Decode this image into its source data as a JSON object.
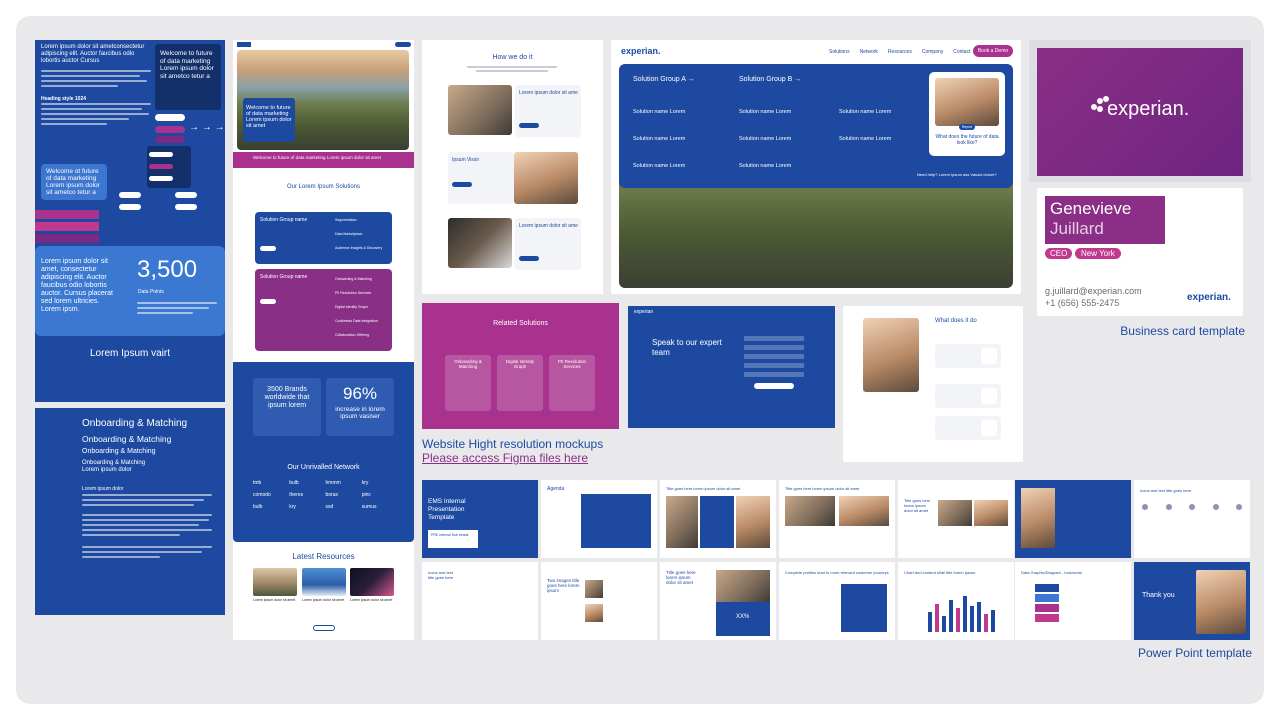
{
  "colors": {
    "brand_blue": "#1d4aa0",
    "brand_magenta": "#a8328d",
    "link_blue": "#1d4aa0",
    "frame_bg": "#e9e9ec"
  },
  "left_col": {
    "intro": "Lorem ipsum dolor sit ametconsectetur adipiscing elit. Auctor faucibus odio lobortis auctor Cursus",
    "welcome_box": "Welcome to future of data marketing Lorem ipsum dolor sit ametco tetur a",
    "heading_style": "Heading style 1024",
    "welcome2": "Welcome ot future of data marketing Lorem ipsum dolor sit ametco tetur a",
    "stat_text": "Lorem ipsum dolor sit amet, consectetur adipiscing elit. Auctor faucibus odio lobortis auctor. Cursus placerat sed lorem ultricies. Lorem ipsm.",
    "stat_number": "3,500",
    "stat_label": "Data Points",
    "bottom_label": "Lorem Ipsum vairt",
    "onboarding": [
      "Onboarding & Matching",
      "Onboarding & Matching",
      "Onboarding & Matching",
      "Onboarding & Matching"
    ],
    "onboarding_sub": "Lorem ipsum dolor",
    "body_label": "Lorem ipsum dolor"
  },
  "web_mock": {
    "hero": "Welcome to future of data marketing Lorem ipsum dolor sit amet",
    "magenta_bar": "Welcome to future of data marketing Lorem ipsum dolor sit amet",
    "solutions_title": "Our Lorem Ipsum Solutions",
    "group1": "Solution Group name",
    "group2": "Solution Group name",
    "group1_items": [
      "Segmentation",
      "Data Marketplace",
      "Audience Insights & Discovery"
    ],
    "group2_items": [
      "Onboarding & Matching",
      "PII Resolution Services",
      "Digital Identity Graph",
      "Cookieless Data Integration",
      "Collaboration Offering"
    ],
    "stat1": "3500 Brands worldwide that ipsum lorem",
    "stat2_num": "96%",
    "stat2_text": "increase in lorem ipsum vasiser",
    "network_title": "Our Unrivalled Network",
    "network_logos": [
      "tmb",
      "bulb",
      "hmmm",
      "kry",
      "comodo",
      "theres",
      "borax",
      "pinc",
      "bulb",
      "kry",
      "ssd",
      "sumus"
    ],
    "latest": "Latest Resources",
    "resources": [
      "Lorem ipsum dolor sit amet",
      "Lorem ipsum dolor sit amet",
      "Lorem ipsum dolor sit amet"
    ]
  },
  "how_we_do": {
    "title": "How we do it",
    "items": [
      "Lorem ipsum dolor sit ame",
      "Ipsum Vissir",
      "Lorem ipsum dolor sit ame"
    ]
  },
  "hero_mock": {
    "logo": "experian.",
    "nav": [
      "Solutions",
      "Network",
      "Resources",
      "Company",
      "Contact"
    ],
    "cta": "Book a Demo",
    "group_a": "Solution Group A →",
    "group_b": "Solution Group B →",
    "items": [
      "Solution name Lorem",
      "Solution name Lorem",
      "Solution name Lorem",
      "Solution name Lorem",
      "Solution name Lorem",
      "Solution name Lorem",
      "Solution name Lorem",
      "Solution name Lorem"
    ],
    "card_text": "What does the future of data look like?",
    "card_btn": "Report",
    "help": "Need help? Lorem Ipsum ass Vasoid dolore?"
  },
  "brand": {
    "logo": "experian.",
    "name_first": "Genevieve",
    "name_last": "Juillard",
    "role": "CEO",
    "city": "New York",
    "email": "g.juillard@experian.com",
    "phone": "+1 (656) 555-2475",
    "caption": "Business card template"
  },
  "related": {
    "title": "Related Solutions",
    "cols": [
      "Onboarding & Matching",
      "Digital Identity Graph",
      "PII Resolution Services"
    ]
  },
  "speak": {
    "logo": "experian",
    "title": "Speak to our expert team"
  },
  "what_does": {
    "title": "What does it do"
  },
  "website_caption": "Website Hight resolution mockups",
  "figma_link": "Please access Figma files here",
  "slides": {
    "row1": [
      "EMS Internal Presentation Template",
      "Agenda",
      "Title goes here lorem ipsum dolor sit amet",
      "Title goes here lorem ipsum dolor sit amet",
      "Title goes here lorem ipsum dolor sit amet",
      "",
      "Icons and text title goes here"
    ],
    "row2": [
      "Icons and text title goes here",
      "Two images title goes here lorem ipsum",
      "Title goes here lorem ipsum dolor sit amet",
      "Complete profiles lead to more relevant customer journeys",
      "Chart and content slide title lorem ipsum",
      "Data Graphic/Diagram - horizontal",
      "Thank you"
    ],
    "cover_sub": "PRE internal Sub heads",
    "kpi": "XX%",
    "caption": "Power Point template"
  }
}
